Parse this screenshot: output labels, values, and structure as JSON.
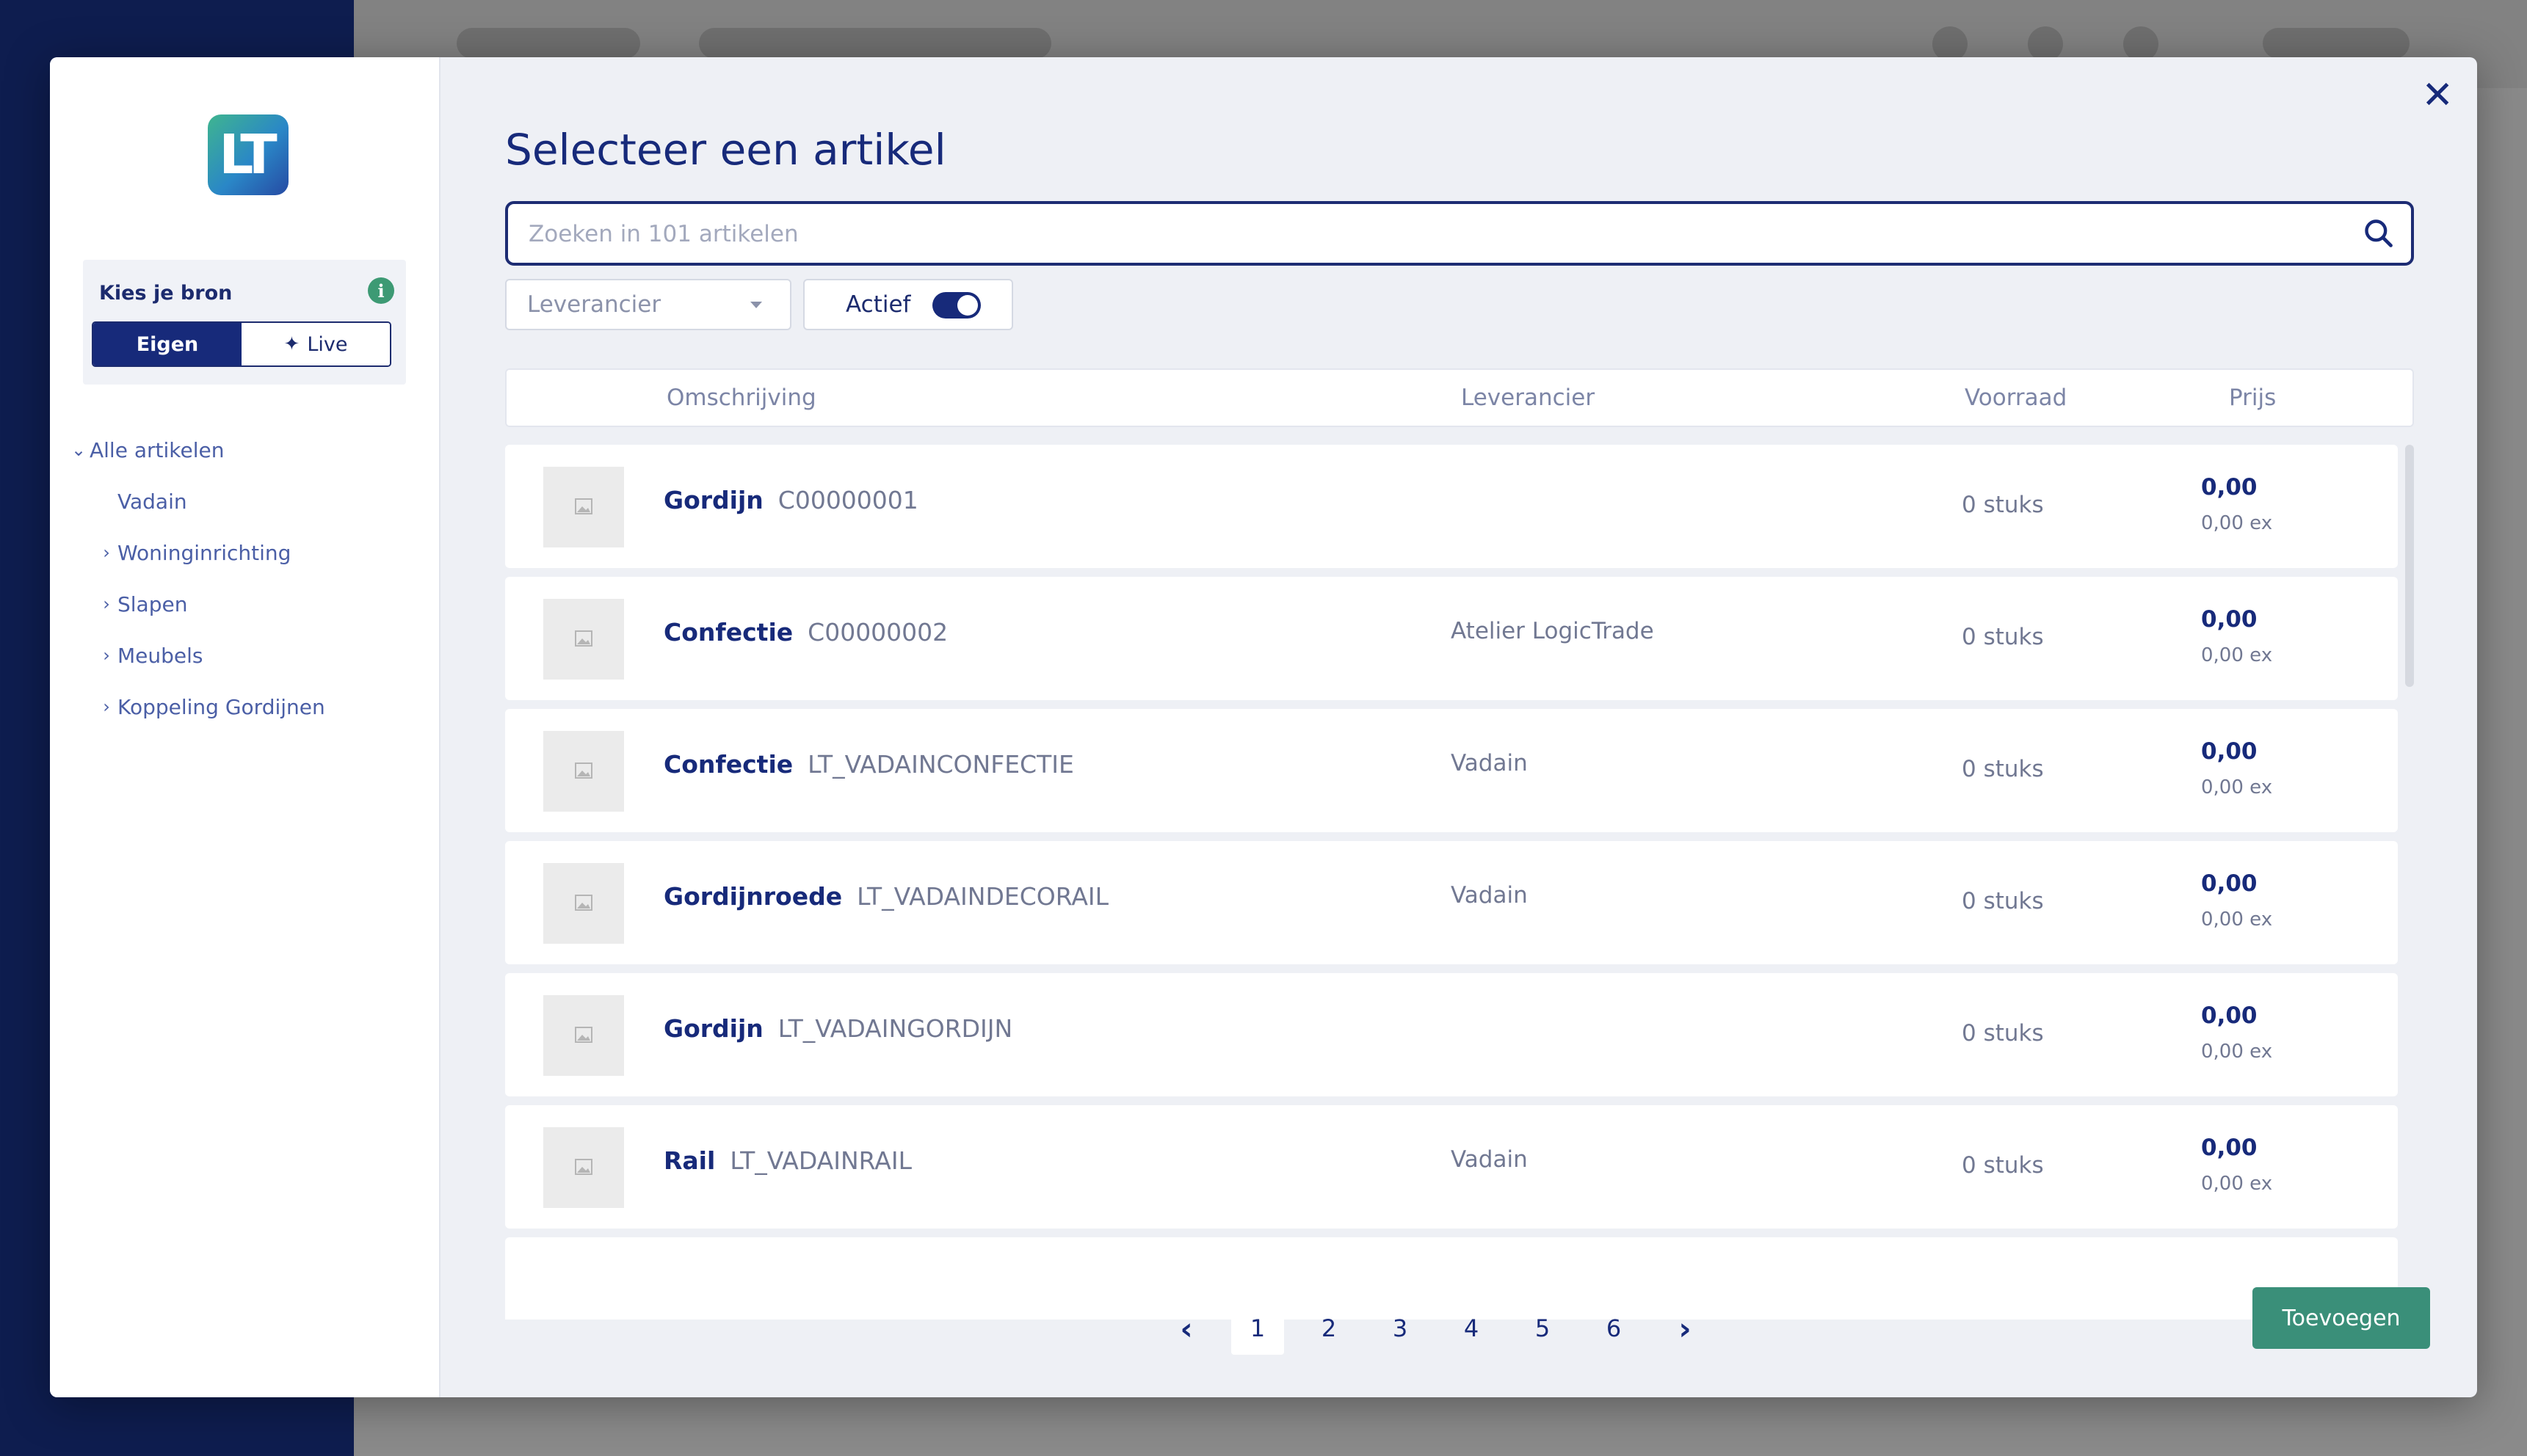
{
  "sidebar": {
    "logo_text": "LT",
    "source_title": "Kies je bron",
    "source_options": [
      "Eigen",
      "Live"
    ],
    "tree": [
      {
        "label": "Alle artikelen",
        "expanded": true
      },
      {
        "label": "Vadain"
      },
      {
        "label": "Woninginrichting"
      },
      {
        "label": "Slapen"
      },
      {
        "label": "Meubels"
      },
      {
        "label": "Koppeling Gordijnen"
      }
    ]
  },
  "dialog": {
    "title": "Selecteer een artikel",
    "search_placeholder": "Zoeken in 101 artikelen",
    "filter_supplier_placeholder": "Leverancier",
    "filter_active_label": "Actief",
    "filter_active_on": true
  },
  "table": {
    "columns": [
      "Omschrijving",
      "Leverancier",
      "Voorraad",
      "Prijs"
    ],
    "rows": [
      {
        "name": "Gordijn",
        "code": "C00000001",
        "supplier": "",
        "stock": "0 stuks",
        "price": "0,00",
        "price_ex": "0,00 ex"
      },
      {
        "name": "Confectie",
        "code": "C00000002",
        "supplier": "Atelier LogicTrade",
        "stock": "0 stuks",
        "price": "0,00",
        "price_ex": "0,00 ex"
      },
      {
        "name": "Confectie",
        "code": "LT_VADAINCONFECTIE",
        "supplier": "Vadain",
        "stock": "0 stuks",
        "price": "0,00",
        "price_ex": "0,00 ex"
      },
      {
        "name": "Gordijnroede",
        "code": "LT_VADAINDECORAIL",
        "supplier": "Vadain",
        "stock": "0 stuks",
        "price": "0,00",
        "price_ex": "0,00 ex"
      },
      {
        "name": "Gordijn",
        "code": "LT_VADAINGORDIJN",
        "supplier": "",
        "stock": "0 stuks",
        "price": "0,00",
        "price_ex": "0,00 ex"
      },
      {
        "name": "Rail",
        "code": "LT_VADAINRAIL",
        "supplier": "Vadain",
        "stock": "0 stuks",
        "price": "0,00",
        "price_ex": "0,00 ex"
      }
    ]
  },
  "pagination": {
    "pages": [
      "1",
      "2",
      "3",
      "4",
      "5",
      "6"
    ],
    "current": "1"
  },
  "actions": {
    "add_label": "Toevoegen"
  },
  "colors": {
    "primary": "#172a7a",
    "accent_green": "#3a8f79",
    "info_green": "#3d9a74"
  }
}
